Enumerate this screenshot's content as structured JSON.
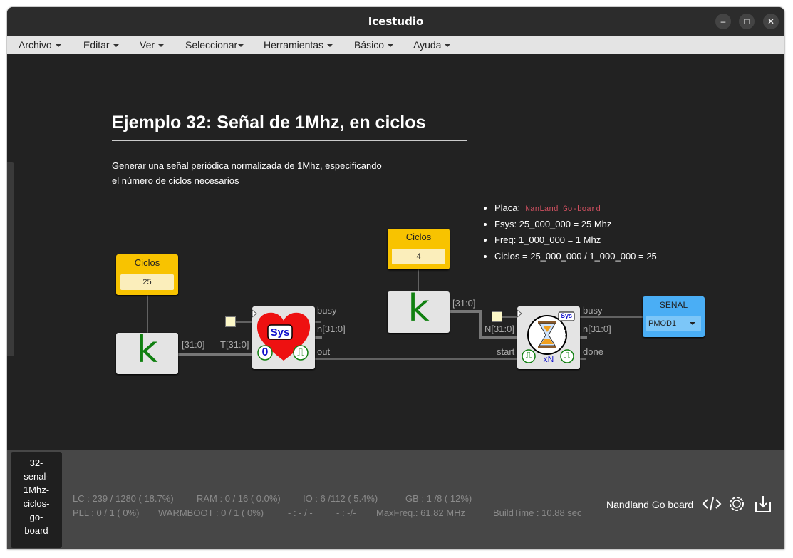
{
  "window": {
    "title": "Icestudio"
  },
  "menu": [
    "Archivo",
    "Editar",
    "Ver",
    "Seleccionar",
    "Herramientas",
    "Básico",
    "Ayuda"
  ],
  "canvas": {
    "heading": "Ejemplo 32: Señal de 1Mhz, en ciclos",
    "description_line1": "Generar una señal periódica normalizada de 1Mhz, especificando",
    "description_line2": "el número de ciclos necesarios",
    "notes": {
      "placa_label": "Placa:",
      "placa_value": "NanLand Go-board",
      "fsys": "Fsys: 25_000_000 = 25 Mhz",
      "freq": "Freq: 1_000_000 = 1 Mhz",
      "ciclos": "Ciclos = 25_000_000 / 1_000_000 = 25"
    },
    "param1": {
      "label": "Ciclos",
      "value": "25"
    },
    "param2": {
      "label": "Ciclos",
      "value": "4"
    },
    "k_label": "k",
    "sys_label": "Sys",
    "zero_label": "0",
    "pulse_label": "⎍",
    "xn_label": "xN",
    "ports": {
      "k1_out": "[31:0]",
      "t_in": "T[31:0]",
      "busy1": "busy",
      "n1": "n[31:0]",
      "out1": "out",
      "k2_out": "[31:0]",
      "n_in": "N[31:0]",
      "start": "start",
      "busy2": "busy",
      "n2": "n[31:0]",
      "done": "done"
    },
    "output": {
      "label": "SENAL",
      "pin": "PMOD1"
    }
  },
  "status": {
    "tab_lines": [
      "32-",
      "senal-",
      "1Mhz-",
      "ciclos-",
      "go-",
      "board"
    ],
    "lc": "LC : 239 / 1280 ( 18.7%)",
    "ram": "RAM : 0 / 16 ( 0.0%)",
    "io": "IO : 6 /112 ( 5.4%)",
    "gb": "GB : 1 /8 ( 12%)",
    "pll": "PLL : 0 / 1 ( 0%)",
    "warmboot": "WARMBOOT : 0 / 1 ( 0%)",
    "blank1": "- : - / -",
    "blank2": "- : -/-",
    "maxfreq": "MaxFreq.: 61.82 MHz",
    "buildtime": "BuildTime : 10.88 sec",
    "board": "Nandland Go board"
  }
}
